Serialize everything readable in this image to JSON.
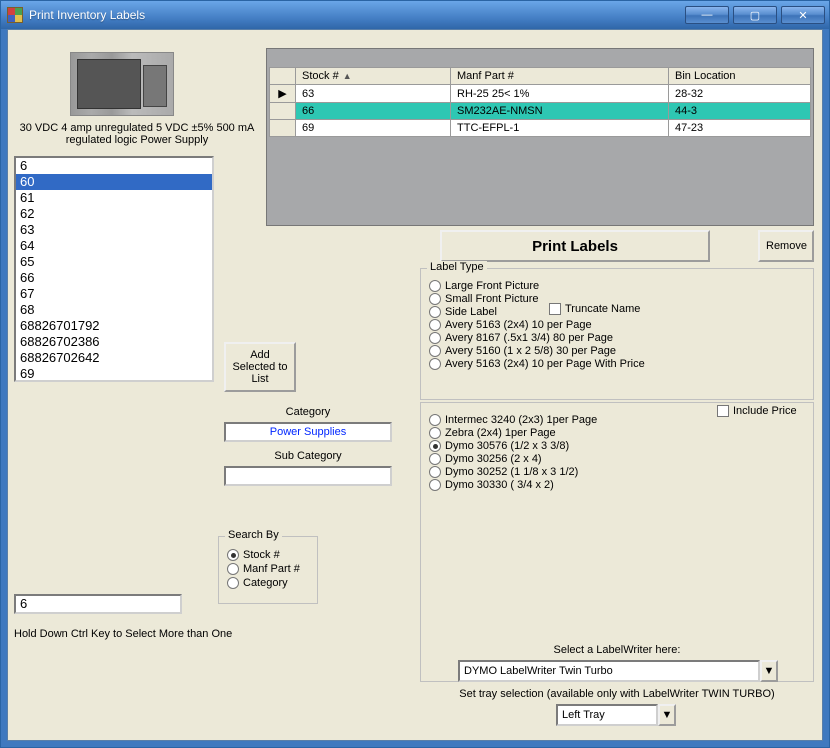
{
  "window": {
    "title": "Print Inventory Labels"
  },
  "description": "30 VDC 4 amp unregulated  5 VDC ±5% 500 mA regulated logic Power Supply",
  "stock_list": {
    "selected_index": 1,
    "items": [
      "6",
      "60",
      "61",
      "62",
      "63",
      "64",
      "65",
      "66",
      "67",
      "68",
      "68826701792",
      "68826702386",
      "68826702642",
      "69"
    ]
  },
  "add_button": "Add Selected to List",
  "category_label": "Category",
  "category_value": "Power Supplies",
  "subcategory_label": "Sub Category",
  "subcategory_value": "",
  "search_by": {
    "legend": "Search By",
    "options": [
      "Stock #",
      "Manf Part #",
      "Category"
    ],
    "selected": 0
  },
  "search_input": "6",
  "hint": "Hold Down Ctrl Key to Select More than One",
  "grid": {
    "columns": [
      "Stock #",
      "Manf Part #",
      "Bin Location"
    ],
    "rows": [
      {
        "stock": "63",
        "manf": "RH-25 25< 1%",
        "bin": "28-32",
        "current": true,
        "selected": false
      },
      {
        "stock": "66",
        "manf": "SM232AE-NMSN",
        "bin": "44-3",
        "current": false,
        "selected": true
      },
      {
        "stock": "69",
        "manf": "TTC-EFPL-1",
        "bin": "47-23",
        "current": false,
        "selected": false
      }
    ]
  },
  "print_button": "Print Labels",
  "remove_button": "Remove",
  "label_type": {
    "legend": "Label Type",
    "truncate_label": "Truncate Name",
    "options": [
      "Large Front Picture",
      "Small Front Picture",
      "Side Label",
      "Avery 5163 (2x4)  10 per Page",
      "Avery 8167 (.5x1 3/4)  80 per Page",
      "Avery 5160 (1 x 2 5/8)  30 per Page",
      "Avery 5163 (2x4)  10 per Page With Price"
    ]
  },
  "printer_options": {
    "include_price_label": "Include Price",
    "options": [
      "Intermec 3240 (2x3) 1per Page",
      "Zebra (2x4) 1per Page",
      "Dymo 30576 (1/2 x 3 3/8)",
      "Dymo 30256 (2 x 4)",
      "Dymo 30252 (1 1/8 x 3 1/2)",
      "Dymo 30330 ( 3/4 x 2)"
    ],
    "selected": 2
  },
  "labelwriter_hint": "Select a LabelWriter here:",
  "labelwriter_value": "DYMO LabelWriter Twin Turbo",
  "tray_hint": "Set tray selection (available only with LabelWriter TWIN TURBO)",
  "tray_value": "Left Tray"
}
